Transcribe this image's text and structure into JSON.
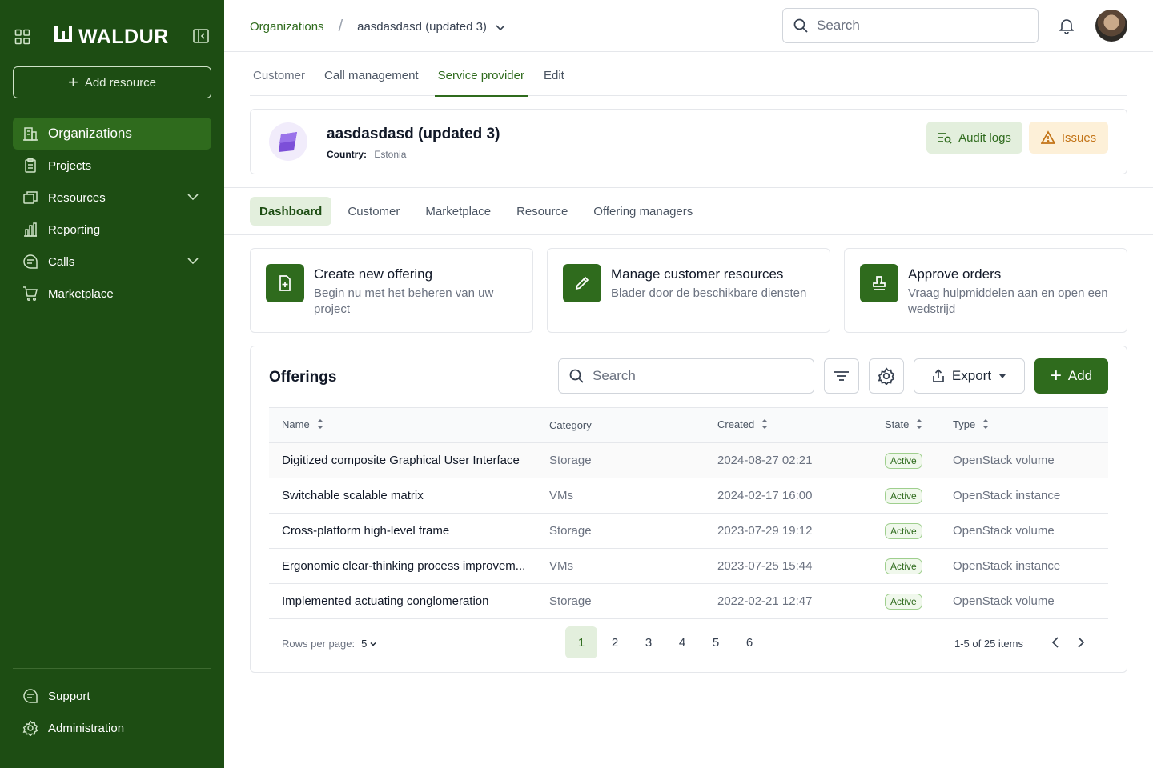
{
  "sidebar": {
    "brand": "WALDUR",
    "add_resource": "Add resource",
    "items": [
      {
        "label": "Organizations",
        "icon": "building-icon",
        "active": true
      },
      {
        "label": "Projects",
        "icon": "clipboard-icon"
      },
      {
        "label": "Resources",
        "icon": "windows-icon",
        "expandable": true
      },
      {
        "label": "Reporting",
        "icon": "chart-icon"
      },
      {
        "label": "Calls",
        "icon": "message-icon",
        "expandable": true
      },
      {
        "label": "Marketplace",
        "icon": "cart-icon"
      }
    ],
    "bottom": [
      {
        "label": "Support",
        "icon": "chat-icon"
      },
      {
        "label": "Administration",
        "icon": "gear-icon"
      }
    ]
  },
  "header": {
    "breadcrumb_root": "Organizations",
    "breadcrumb_current": "aasdasdasd (updated 3)",
    "search_placeholder": "Search"
  },
  "tabs": [
    "Customer",
    "Call management",
    "Service provider",
    "Edit"
  ],
  "active_tab": "Service provider",
  "org": {
    "name": "aasdasdasd (updated 3)",
    "country_label": "Country:",
    "country": "Estonia",
    "audit_logs": "Audit logs",
    "issues": "Issues"
  },
  "subtabs": [
    "Dashboard",
    "Customer",
    "Marketplace",
    "Resource",
    "Offering managers"
  ],
  "actions": [
    {
      "title": "Create new offering",
      "desc": "Begin nu met het beheren van uw project"
    },
    {
      "title": "Manage customer resources",
      "desc": "Blader door de beschikbare diensten"
    },
    {
      "title": "Approve orders",
      "desc": "Vraag hulpmiddelen aan en open een wedstrijd"
    }
  ],
  "offerings": {
    "title": "Offerings",
    "search_placeholder": "Search",
    "export": "Export",
    "add": "Add",
    "columns": [
      "Name",
      "Category",
      "Created",
      "State",
      "Type"
    ],
    "rows": [
      {
        "name": "Digitized composite Graphical User Interface",
        "category": "Storage",
        "created": "2024-08-27 02:21",
        "state": "Active",
        "type": "OpenStack volume"
      },
      {
        "name": "Switchable scalable matrix",
        "category": "VMs",
        "created": "2024-02-17 16:00",
        "state": "Active",
        "type": "OpenStack instance"
      },
      {
        "name": "Cross-platform high-level frame",
        "category": "Storage",
        "created": "2023-07-29 19:12",
        "state": "Active",
        "type": "OpenStack volume"
      },
      {
        "name": "Ergonomic clear-thinking process improvem...",
        "category": "VMs",
        "created": "2023-07-25 15:44",
        "state": "Active",
        "type": "OpenStack instance"
      },
      {
        "name": "Implemented actuating conglomeration",
        "category": "Storage",
        "created": "2022-02-21 12:47",
        "state": "Active",
        "type": "OpenStack volume"
      }
    ],
    "rows_per_page_label": "Rows per page:",
    "rows_per_page": "5",
    "pages": [
      "1",
      "2",
      "3",
      "4",
      "5",
      "6"
    ],
    "current_page": "1",
    "range": "1-5 of 25 items"
  },
  "colors": {
    "sidebar": "#1d4d13",
    "accent": "#2f6b1d",
    "warning": "#c27316"
  }
}
